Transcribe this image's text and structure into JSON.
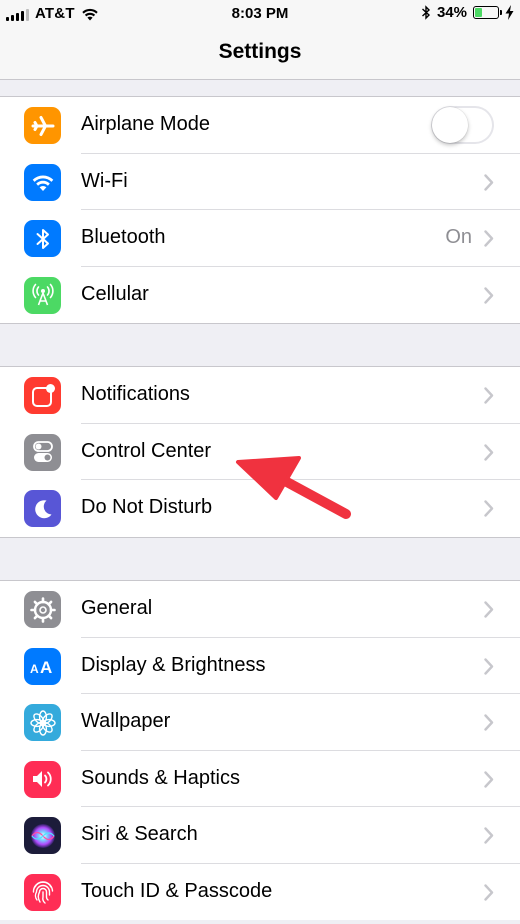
{
  "status_bar": {
    "carrier": "AT&T",
    "time": "8:03 PM",
    "battery_percent_text": "34%",
    "battery_level": 0.34
  },
  "nav": {
    "title": "Settings"
  },
  "groups": [
    {
      "rows": [
        {
          "label": "Airplane Mode",
          "icon": "airplane-icon",
          "icon_color": "#ff9500",
          "accessory": "toggle",
          "toggle_on": false
        },
        {
          "label": "Wi-Fi",
          "icon": "wifi-icon",
          "icon_color": "#007aff",
          "accessory": "chevron"
        },
        {
          "label": "Bluetooth",
          "icon": "bluetooth-icon",
          "icon_color": "#007aff",
          "accessory": "chevron",
          "detail": "On"
        },
        {
          "label": "Cellular",
          "icon": "cellular-antenna-icon",
          "icon_color": "#4cd964",
          "accessory": "chevron"
        }
      ]
    },
    {
      "rows": [
        {
          "label": "Notifications",
          "icon": "notifications-icon",
          "icon_color": "#ff3b30",
          "accessory": "chevron"
        },
        {
          "label": "Control Center",
          "icon": "control-center-icon",
          "icon_color": "#8e8e93",
          "accessory": "chevron"
        },
        {
          "label": "Do Not Disturb",
          "icon": "moon-icon",
          "icon_color": "#5856d6",
          "accessory": "chevron"
        }
      ]
    },
    {
      "rows": [
        {
          "label": "General",
          "icon": "gear-icon",
          "icon_color": "#8e8e93",
          "accessory": "chevron"
        },
        {
          "label": "Display & Brightness",
          "icon": "text-size-icon",
          "icon_color": "#007aff",
          "accessory": "chevron"
        },
        {
          "label": "Wallpaper",
          "icon": "wallpaper-flower-icon",
          "icon_color": "#34aadc",
          "accessory": "chevron"
        },
        {
          "label": "Sounds & Haptics",
          "icon": "speaker-icon",
          "icon_color": "#ff2d55",
          "accessory": "chevron"
        },
        {
          "label": "Siri & Search",
          "icon": "siri-icon",
          "icon_color": "#1c1c3a",
          "accessory": "chevron"
        },
        {
          "label": "Touch ID & Passcode",
          "icon": "fingerprint-icon",
          "icon_color": "#ff2d55",
          "accessory": "chevron"
        }
      ]
    }
  ],
  "annotation": {
    "icon": "red-arrow-icon",
    "color": "#f0323f"
  }
}
